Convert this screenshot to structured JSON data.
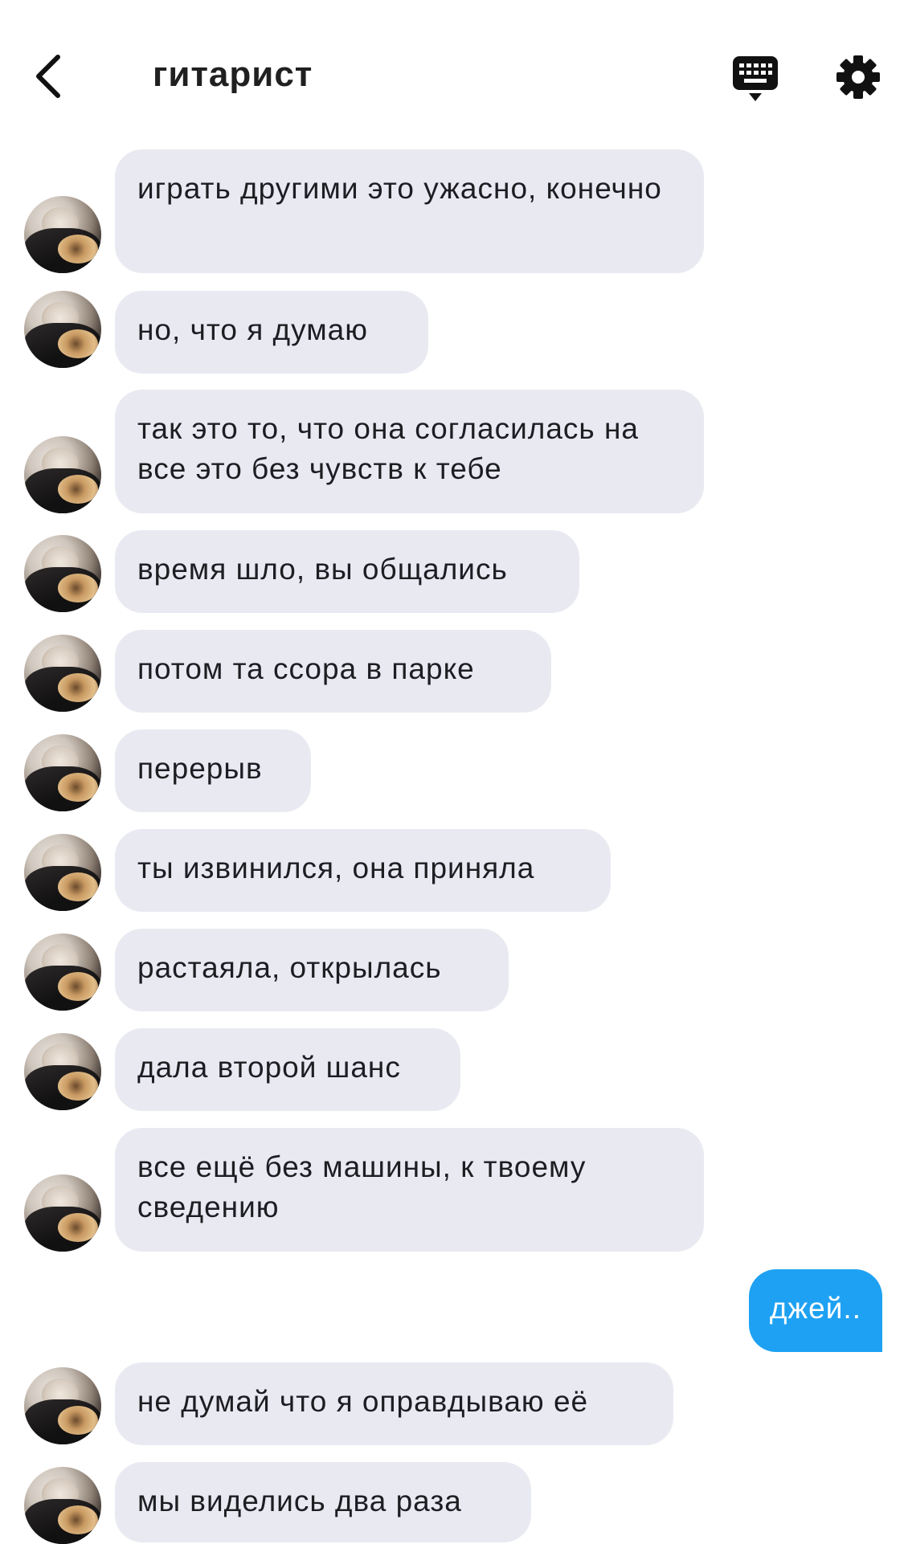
{
  "header": {
    "title": "гитарист",
    "back_icon": "chevron-left-icon",
    "keyboard_icon": "keyboard-icon",
    "settings_icon": "gear-icon"
  },
  "colors": {
    "incoming_bubble": "#e9eaf1",
    "outgoing_bubble": "#1ea1f2",
    "text": "#1d1d22"
  },
  "messages": [
    {
      "direction": "incoming",
      "text": "играть другими это ужасно, конечно"
    },
    {
      "direction": "incoming",
      "text": "но, что я думаю"
    },
    {
      "direction": "incoming",
      "text": "так это то, что она согласилась на все это без чувств к тебе"
    },
    {
      "direction": "incoming",
      "text": "время шло, вы общались"
    },
    {
      "direction": "incoming",
      "text": "потом та ссора в парке"
    },
    {
      "direction": "incoming",
      "text": "перерыв"
    },
    {
      "direction": "incoming",
      "text": "ты извинился, она приняла"
    },
    {
      "direction": "incoming",
      "text": "растаяла, открылась"
    },
    {
      "direction": "incoming",
      "text": "дала второй шанс"
    },
    {
      "direction": "incoming",
      "text": "все ещё без машины, к твоему сведению"
    },
    {
      "direction": "outgoing",
      "text": "джей.."
    },
    {
      "direction": "incoming",
      "text": "не думай что я оправдываю её"
    },
    {
      "direction": "incoming",
      "text": "мы виделись два раза"
    }
  ]
}
